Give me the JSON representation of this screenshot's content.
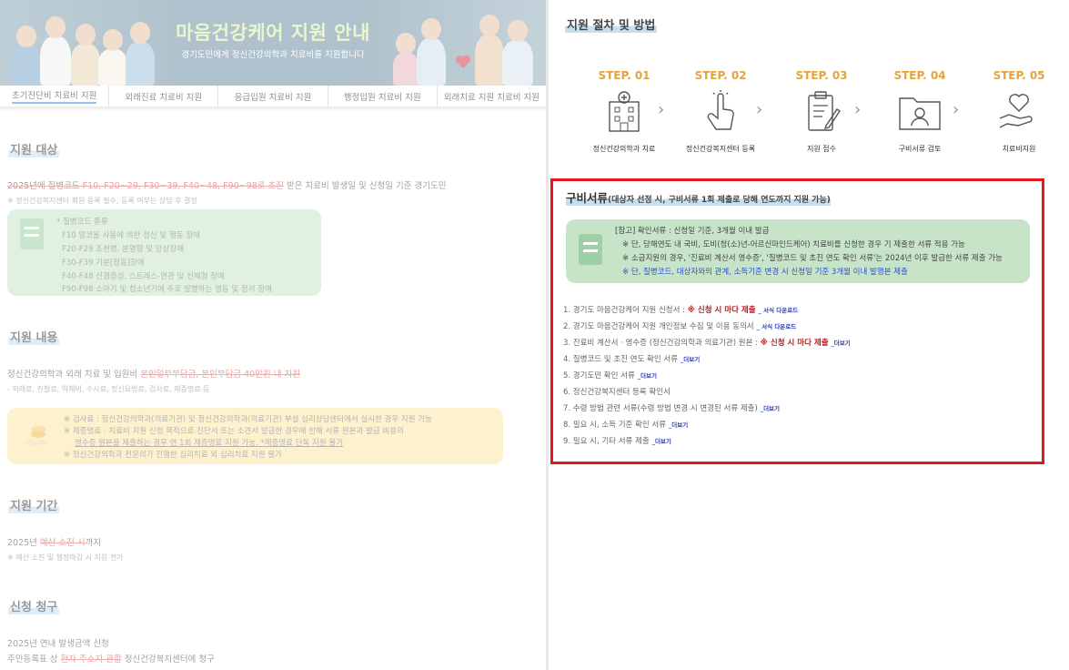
{
  "banner": {
    "title": "마음건강케어 지원 안내",
    "subtitle": "경기도민에게 정신건강의학과 치료비를 지원합니다"
  },
  "tabs": [
    {
      "label": "초기진단비 치료비 지원",
      "active": true
    },
    {
      "label": "외래진료 치료비 지원",
      "active": false
    },
    {
      "label": "응급입원 치료비 지원",
      "active": false
    },
    {
      "label": "행정입원 치료비 지원",
      "active": false
    },
    {
      "label": "외래치료 지원 치료비 지원",
      "active": false
    }
  ],
  "target": {
    "title": "지원 대상",
    "main_prefix": "2025년에 질병코드 ",
    "main_codes": "F10, F20~29, F30~39, F40~48, F90~98로 초진",
    "main_suffix": " 받은 치료비 발생일 및 신청일 기준 경기도민",
    "note": "※ 정신건강복지센터 회원 등록 필수, 등록 여부는 상담 후 결정",
    "codes_box": [
      "* 질병코드 종류",
      "F10 알코올 사용에 의한 정신 및 행동 장애",
      "F20-F29 조현병, 분열형 및 망상장애",
      "F30-F39 기분[정동]장애",
      "F40-F48 신경증성, 스트레스-연관 및 신체형 장애",
      "F90-F98 소아기 및 청소년기에 주로 발병하는 행동 및 정서 장애"
    ]
  },
  "content": {
    "title": "지원 내용",
    "main_prefix": "정신건강의학과 외래 치료 및 입원비 ",
    "main_highlight": "본인일부부담금, 본인부담금 40만원 내 지원",
    "note": "- 외래료, 진찰료, 약제비, 수사료, 정신요법료, 검사료, 제증명료 등",
    "yellow_box": [
      "※ 검사료 : 정신건강의학과(의료기관) 및 정신건강의학과(의료기관) 부설 심리상담센터에서 실시한 경우 지원 가능",
      "※ 제증명료 : 치료비 지원 신청 목적으로 진단서 또는 소견서 발급한 경우에 한해 서류 원본과 발급 비용의",
      "영수증 원본을 제출하는 경우 연 1회 제증명료 지원 가능. *제증명료 단독 지원 불가",
      "※ 정신건강의학과 전문의가 진행한 심리치료 외 심리치료 지원 불가"
    ]
  },
  "period": {
    "title": "지원 기간",
    "main_prefix": "2025년 ",
    "main_highlight": "예산 소진 시",
    "main_suffix": "까지",
    "note": "※ 예산 소진 및 행정마감 시 지원 전가"
  },
  "apply": {
    "title": "신청 청구",
    "line1": "2025년 연내 발생금액 신청",
    "line2_prefix": "주민등록표 상 ",
    "line2_highlight": "환자 주소지 관할",
    "line2_suffix": " 정신건강복지센터에 청구"
  },
  "procedure": {
    "title": "지원 절차 및 방법",
    "steps": [
      {
        "label": "STEP. 01",
        "desc": "정신건강의학과 치료",
        "icon": "hospital-icon"
      },
      {
        "label": "STEP. 02",
        "desc": "정신건강복지센터 등록",
        "icon": "tap-hand-icon"
      },
      {
        "label": "STEP. 03",
        "desc": "지원 접수",
        "icon": "clipboard-pen-icon"
      },
      {
        "label": "STEP. 04",
        "desc": "구비서류 검토",
        "icon": "id-folder-icon"
      },
      {
        "label": "STEP. 05",
        "desc": "치료비지원",
        "icon": "hand-heart-icon"
      }
    ]
  },
  "docs": {
    "title": "구비서류",
    "subtitle": "(대상자 선정 시, 구비서류 1회 제출로 당해 연도까지 지원 가능)",
    "note_lines": [
      "[참고] 확인서류 : 신청일 기준, 3개월 이내 발급",
      "※ 단, 당해연도 내 국비, 도비(청(소)년-어르신마인드케어) 치료비를 신청한 경우 기 제출한 서류 적용 가능",
      "※ 소급지원의 경우, '진료비 계산서 영수증', '질병코드 및 초진 연도 확인 서류'는 2024년 이후 발급한 서류 제출 가능",
      "※ 단, 질병코드, 대상자와의 관계, 소득기준 변경 시 신청일 기준 3개월 이내 발행본 제출"
    ],
    "items": [
      {
        "text": "1. 경기도 마음건강케어 지원 신청서 : ",
        "required": "※ 신청 시 마다 제출",
        "link": "_ 서식 다운로드"
      },
      {
        "text": "2. 경기도 마음건강케어 지원 개인정보 수집 및 이용 동의서",
        "required": "",
        "link": "_ 서식 다운로드"
      },
      {
        "text": "3. 진료비 계산서 · 영수증 (정신건강의학과 의료기관) 원본 : ",
        "required": "※ 신청 시 마다 제출",
        "link": "_더보기"
      },
      {
        "text": "4. 질병코드 및 초진 연도 확인 서류",
        "required": "",
        "link": "_더보기"
      },
      {
        "text": "5. 경기도민 확인 서류",
        "required": "",
        "link": "_더보기"
      },
      {
        "text": "6. 정신건강복지센터 등록 확인서",
        "required": "",
        "link": ""
      },
      {
        "text": "7. 수령 방법 관련 서류(수령 방법 변경 시 변경된 서류 제출)",
        "required": "",
        "link": "_더보기"
      },
      {
        "text": "8. 필요 시, 소득 기준 확인 서류",
        "required": "",
        "link": "_더보기"
      },
      {
        "text": "9. 필요 시, 기타 서류 제출",
        "required": "",
        "link": "_더보기"
      }
    ]
  },
  "colors": {
    "accent_green": "#d7f0a4",
    "step_orange": "#e5a33a",
    "box_green": "#c7e4c8",
    "box_yellow": "#fde6a4",
    "highlight_red": "#e0191f"
  }
}
